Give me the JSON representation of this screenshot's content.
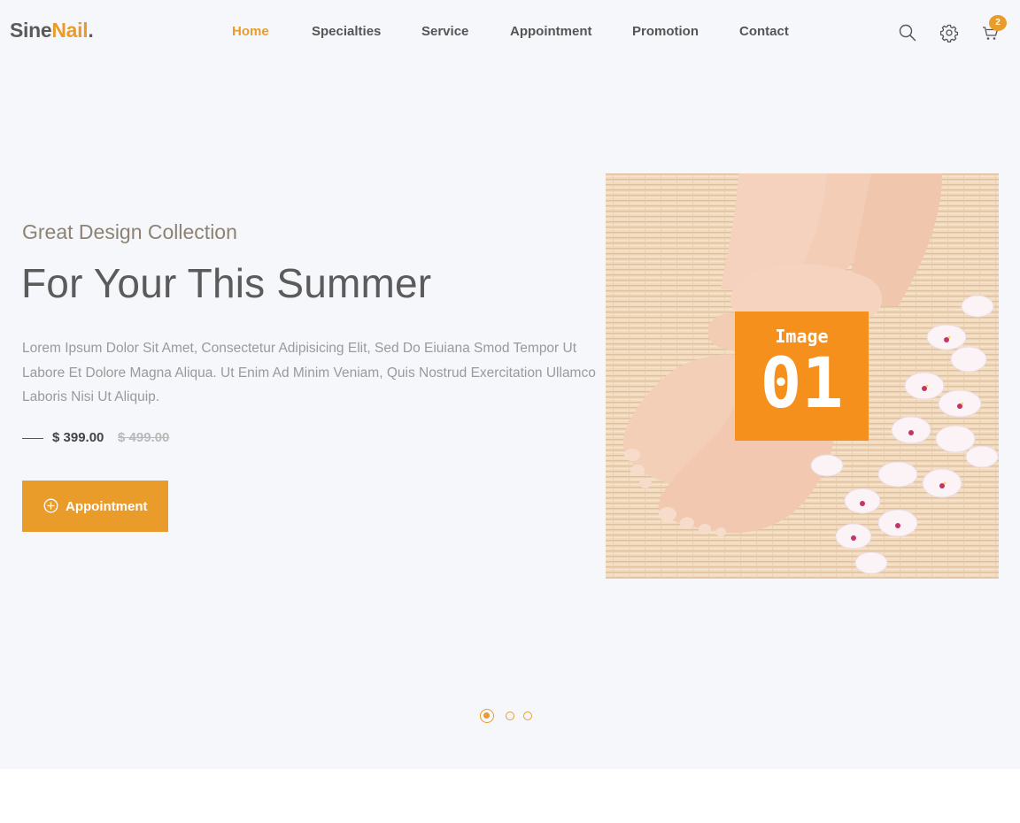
{
  "brand": {
    "part1": "Sine",
    "part2": "Nail",
    "part3": "."
  },
  "nav": {
    "items": [
      {
        "label": "Home",
        "active": true
      },
      {
        "label": "Specialties",
        "active": false
      },
      {
        "label": "Service",
        "active": false
      },
      {
        "label": "Appointment",
        "active": false
      },
      {
        "label": "Promotion",
        "active": false
      },
      {
        "label": "Contact",
        "active": false
      }
    ]
  },
  "header_icons": {
    "search": "search-icon",
    "settings": "gear-icon",
    "cart": "cart-icon",
    "cart_count": "2"
  },
  "hero": {
    "eyebrow": "Great Design Collection",
    "headline": "For Your This Summer",
    "description": "Lorem Ipsum Dolor Sit Amet, Consectetur Adipisicing Elit, Sed Do Eiuiana Smod Tempor Ut Labore Et Dolore Magna Aliqua. Ut Enim Ad Minim Veniam, Quis Nostrud Exercitation Ullamco Laboris Nisi Ut Aliquip.",
    "price_new": "$ 399.00",
    "price_old": "$ 499.00",
    "button_label": "Appointment",
    "image_badge_line1": "Image",
    "image_badge_line2": "01"
  },
  "slider": {
    "dot_count": 3,
    "active_index": 0
  },
  "colors": {
    "accent": "#ea9c2b",
    "badge": "#f5901d",
    "hero_bg": "#f6f7fb"
  }
}
